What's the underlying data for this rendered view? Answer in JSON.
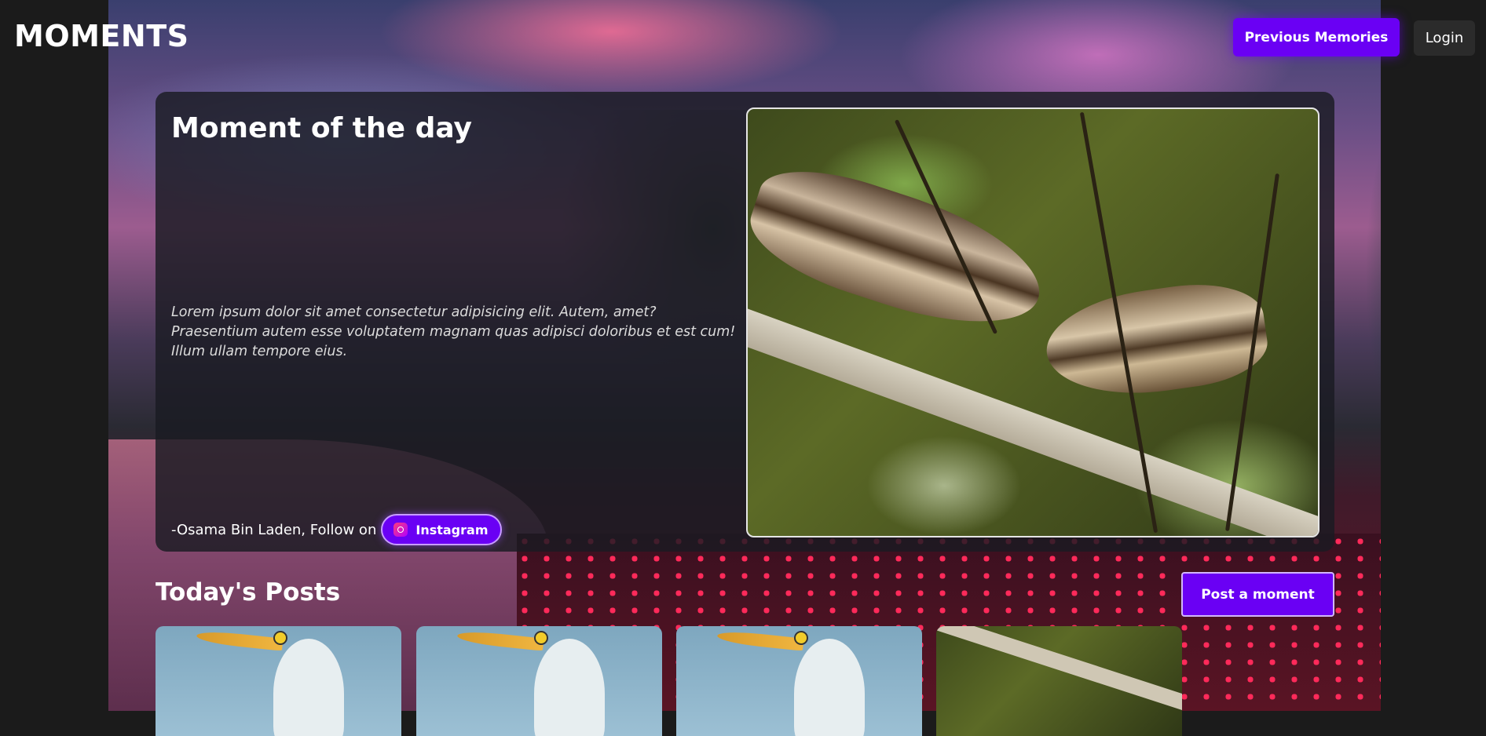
{
  "header": {
    "logo": "MOMENTS",
    "previous_memories_label": "Previous Memories",
    "login_label": "Login"
  },
  "hero": {
    "title": "Moment of the day",
    "quote": "Lorem ipsum dolor sit amet consectetur adipisicing elit. Autem, amet? Praesentium autem esse voluptatem magnam quas adipisci doloribus et est cum! Illum ullam tempore eius.",
    "author_text": "-Osama Bin Laden, Follow on",
    "instagram_label": "Instagram",
    "instagram_icon": "instagram-icon"
  },
  "posts": {
    "title": "Today's Posts",
    "post_button_label": "Post a moment",
    "cards": [
      "egret",
      "egret",
      "egret",
      "squirrels"
    ]
  },
  "colors": {
    "accent": "#6a00f4",
    "page_bg": "#1b1b1b",
    "card_bg": "#1a1b22",
    "login_bg": "#2b2b2b"
  }
}
